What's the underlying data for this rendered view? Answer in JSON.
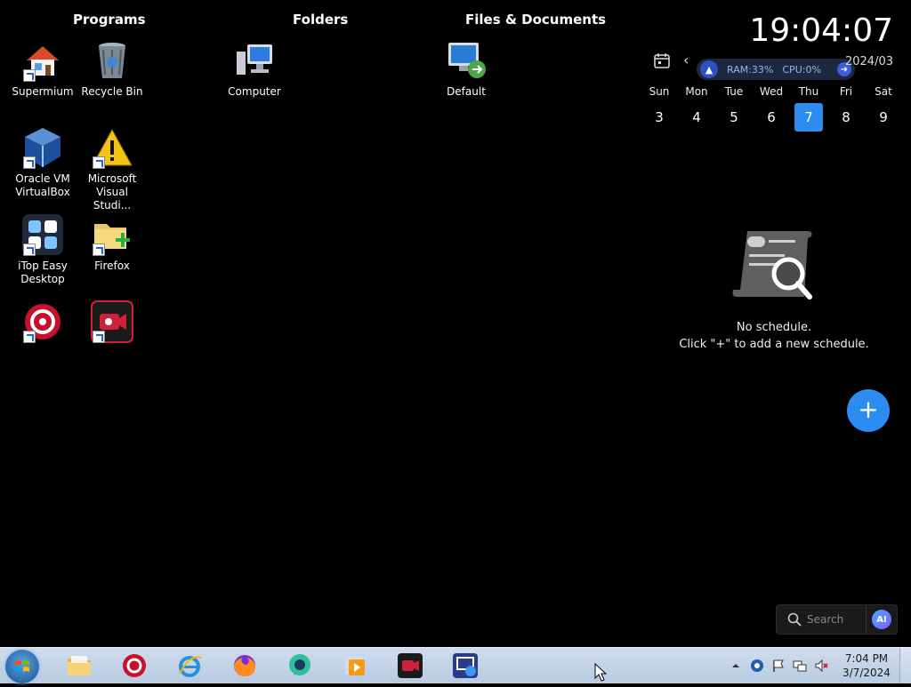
{
  "sections": {
    "programs": "Programs",
    "folders": "Folders",
    "files": "Files & Documents"
  },
  "desktop_icons": {
    "supermium": "Supermium",
    "recycle_bin": "Recycle Bin",
    "computer": "Computer",
    "default": "Default",
    "virtualbox": "Oracle VM VirtualBox",
    "visual_studio": "Microsoft Visual Studi...",
    "itop": "iTop Easy Desktop",
    "firefox": "Firefox"
  },
  "widget": {
    "clock": "19:04:07",
    "month": "2024/03",
    "monitor": {
      "ram": "RAM:33%",
      "cpu": "CPU:0%"
    },
    "weekdays": [
      "Sun",
      "Mon",
      "Tue",
      "Wed",
      "Thu",
      "Fri",
      "Sat"
    ],
    "days": [
      "3",
      "4",
      "5",
      "6",
      "7",
      "8",
      "9"
    ],
    "selected_day": "7",
    "empty_title": "No schedule.",
    "empty_hint": "Click \"+\" to add a new schedule.",
    "add_label": "+"
  },
  "search": {
    "placeholder": "Search",
    "ai_label": "AI"
  },
  "taskbar": {
    "time": "7:04 PM",
    "date": "3/7/2024"
  },
  "colors": {
    "accent": "#2d8cf0",
    "taskbar": "#c4d4e8"
  }
}
